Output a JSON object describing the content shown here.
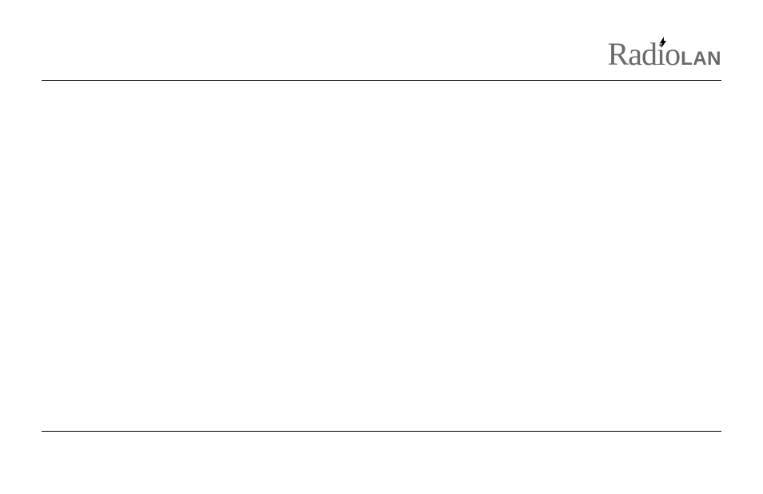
{
  "logo": {
    "prefix": "Radio",
    "suffix": "LAN"
  }
}
